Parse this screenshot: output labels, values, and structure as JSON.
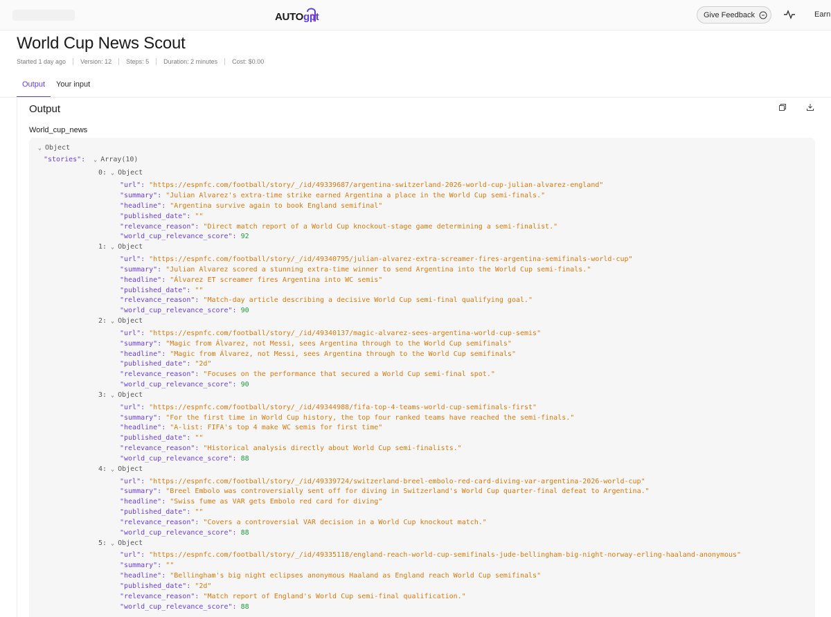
{
  "topbar": {
    "logo_text_a": "AUTO",
    "logo_text_b": "gpt",
    "feedback_label": "Give Feedback",
    "earn_label": "Earn"
  },
  "header": {
    "title": "World Cup News Scout",
    "meta": [
      "Started 1 day ago",
      "Version: 12",
      "Steps: 5",
      "Duration: 2 minutes",
      "Cost: $0.00"
    ]
  },
  "tabs": [
    {
      "label": "Output",
      "active": true
    },
    {
      "label": "Your input",
      "active": false
    }
  ],
  "output": {
    "heading": "Output",
    "field_name": "World_cup_news",
    "root_type": "Object",
    "stories_key": "\"stories\":",
    "stories_type": "Array(10)",
    "item_type": "Object",
    "stories": [
      {
        "index": "0:",
        "url": "\"https://espnfc.com/football/story/_/id/49339687/argentina-switzerland-2026-world-cup-julian-alvarez-england\"",
        "summary": "\"Julian Alvarez's extra-time strike earned Argentina a place in the World Cup semi-finals.\"",
        "headline": "\"Argentina survive again to book England semifinal\"",
        "published_date": "\"\"",
        "relevance_reason": "\"Direct match report of a World Cup knockout-stage game determining a semi-finalist.\"",
        "world_cup_relevance_score": "92"
      },
      {
        "index": "1:",
        "url": "\"https://espnfc.com/football/story/_/id/49340795/julian-alvarez-extra-screamer-fires-argentina-semifinals-world-cup\"",
        "summary": "\"Julian Alvarez scored a stunning extra-time winner to send Argentina into the World Cup semi-finals.\"",
        "headline": "\"Álvarez ET screamer fires Argentina into WC semis\"",
        "published_date": "\"\"",
        "relevance_reason": "\"Match-day article describing a decisive World Cup semi-final qualifying goal.\"",
        "world_cup_relevance_score": "90"
      },
      {
        "index": "2:",
        "url": "\"https://espnfc.com/football/story/_/id/49340137/magic-alvarez-sees-argentina-world-cup-semis\"",
        "summary": "\"Magic from Álvarez, not Messi, sees Argentina through to the World Cup semifinals\"",
        "headline": "\"Magic from Álvarez, not Messi, sees Argentina through to the World Cup semifinals\"",
        "published_date": "\"2d\"",
        "relevance_reason": "\"Focuses on the performance that secured a World Cup semi-final spot.\"",
        "world_cup_relevance_score": "90"
      },
      {
        "index": "3:",
        "url": "\"https://espnfc.com/football/story/_/id/49344988/fifa-top-4-teams-world-cup-semifinals-first\"",
        "summary": "\"For the first time in World Cup history, the top four ranked teams have reached the semi-finals.\"",
        "headline": "\"A-list: FIFA's top 4 make WC semis for first time\"",
        "published_date": "\"\"",
        "relevance_reason": "\"Historical analysis directly about World Cup semi-finalists.\"",
        "world_cup_relevance_score": "88"
      },
      {
        "index": "4:",
        "url": "\"https://espnfc.com/football/story/_/id/49339724/switzerland-breel-embolo-red-card-diving-var-argentina-2026-world-cup\"",
        "summary": "\"Breel Embolo was controversially sent off for diving in Switzerland's World Cup quarter-final defeat to Argentina.\"",
        "headline": "\"Swiss fume as VAR gets Embolo red card for diving\"",
        "published_date": "\"\"",
        "relevance_reason": "\"Covers a controversial VAR decision in a World Cup knockout match.\"",
        "world_cup_relevance_score": "88"
      },
      {
        "index": "5:",
        "url": "\"https://espnfc.com/football/story/_/id/49335118/england-reach-world-cup-semifinals-jude-bellingham-big-night-norway-erling-haaland-anonymous\"",
        "summary": "\"\"",
        "headline": "\"Bellingham's big night eclipses anonymous Haaland as England reach World Cup semifinals\"",
        "published_date": "\"2d\"",
        "relevance_reason": "\"Match report of England's World Cup semi-final qualification.\"",
        "world_cup_relevance_score": "88"
      }
    ],
    "field_keys": {
      "url": "\"url\":",
      "summary": "\"summary\":",
      "headline": "\"headline\":",
      "published_date": "\"published_date\":",
      "relevance_reason": "\"relevance_reason\":",
      "world_cup_relevance_score": "\"world_cup_relevance_score\":"
    }
  },
  "colors": {
    "accent": "#5b3ee6",
    "json_key": "#6b3fd6",
    "json_string": "#d9780f",
    "json_number": "#1e9c3a"
  }
}
